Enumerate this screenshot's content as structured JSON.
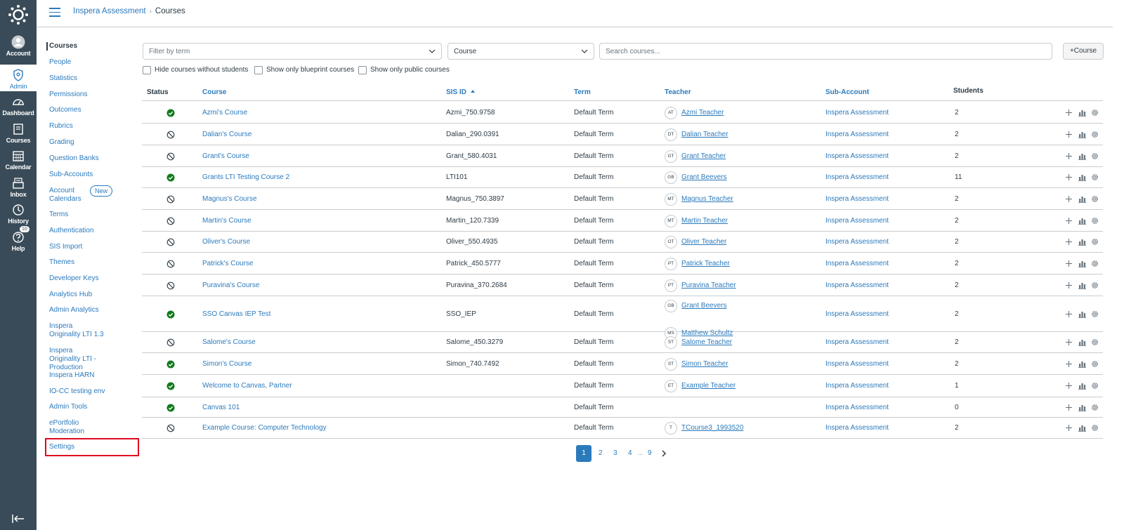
{
  "global_nav": {
    "items": [
      {
        "label": "Account",
        "icon": "account-icon"
      },
      {
        "label": "Admin",
        "icon": "admin-shield-icon"
      },
      {
        "label": "Dashboard",
        "icon": "dashboard-icon"
      },
      {
        "label": "Courses",
        "icon": "courses-icon"
      },
      {
        "label": "Calendar",
        "icon": "calendar-icon"
      },
      {
        "label": "Inbox",
        "icon": "inbox-icon"
      },
      {
        "label": "History",
        "icon": "history-icon"
      },
      {
        "label": "Help",
        "icon": "help-icon",
        "badge": "10"
      }
    ]
  },
  "breadcrumb": {
    "root": "Inspera Assessment",
    "current": "Courses"
  },
  "sidebar": {
    "items": [
      {
        "label": "Courses"
      },
      {
        "label": "People"
      },
      {
        "label": "Statistics"
      },
      {
        "label": "Permissions"
      },
      {
        "label": "Outcomes"
      },
      {
        "label": "Rubrics"
      },
      {
        "label": "Grading"
      },
      {
        "label": "Question Banks"
      },
      {
        "label": "Sub-Accounts"
      },
      {
        "label": "Account Calendars",
        "badge": "New"
      },
      {
        "label": "Terms"
      },
      {
        "label": "Authentication"
      },
      {
        "label": "SIS Import"
      },
      {
        "label": "Themes"
      },
      {
        "label": "Developer Keys"
      },
      {
        "label": "Analytics Hub"
      },
      {
        "label": "Admin Analytics"
      },
      {
        "label": "Inspera Originality LTI 1.3"
      },
      {
        "label": "Inspera Originality LTI - Production"
      },
      {
        "label": "Inspera HARN"
      },
      {
        "label": "IO-CC testing env"
      },
      {
        "label": "Admin Tools"
      },
      {
        "label": "ePortfolio Moderation"
      },
      {
        "label": "Settings"
      }
    ]
  },
  "filters": {
    "term_placeholder": "Filter by term",
    "type_value": "Course",
    "search_placeholder": "Search courses...",
    "add_course_label": "+Course",
    "checkboxes": [
      "Hide courses without students",
      "Show only blueprint courses",
      "Show only public courses"
    ]
  },
  "table": {
    "headers": {
      "status": "Status",
      "course": "Course",
      "sis": "SIS ID",
      "term": "Term",
      "teacher": "Teacher",
      "sub": "Sub-Account",
      "students": "Students"
    },
    "rows": [
      {
        "status": "published",
        "course": "Azmi's Course",
        "sis": "Azmi_750.9758",
        "term": "Default Term",
        "teachers": [
          {
            "initials": "AT",
            "name": "Azmi Teacher"
          }
        ],
        "sub": "Inspera Assessment",
        "students": "2"
      },
      {
        "status": "unpublished",
        "course": "Dalian's Course",
        "sis": "Dalian_290.0391",
        "term": "Default Term",
        "teachers": [
          {
            "initials": "DT",
            "name": "Dalian Teacher"
          }
        ],
        "sub": "Inspera Assessment",
        "students": "2"
      },
      {
        "status": "unpublished",
        "course": "Grant's Course",
        "sis": "Grant_580.4031",
        "term": "Default Term",
        "teachers": [
          {
            "initials": "GT",
            "name": "Grant Teacher"
          }
        ],
        "sub": "Inspera Assessment",
        "students": "2"
      },
      {
        "status": "published",
        "course": "Grants LTI Testing Course 2",
        "sis": "LTI101",
        "term": "Default Term",
        "teachers": [
          {
            "initials": "GB",
            "name": "Grant Beevers"
          }
        ],
        "sub": "Inspera Assessment",
        "students": "11"
      },
      {
        "status": "unpublished",
        "course": "Magnus's Course",
        "sis": "Magnus_750.3897",
        "term": "Default Term",
        "teachers": [
          {
            "initials": "MT",
            "name": "Magnus Teacher"
          }
        ],
        "sub": "Inspera Assessment",
        "students": "2"
      },
      {
        "status": "unpublished",
        "course": "Martin's Course",
        "sis": "Martin_120.7339",
        "term": "Default Term",
        "teachers": [
          {
            "initials": "MT",
            "name": "Martin Teacher"
          }
        ],
        "sub": "Inspera Assessment",
        "students": "2"
      },
      {
        "status": "unpublished",
        "course": "Oliver's Course",
        "sis": "Oliver_550.4935",
        "term": "Default Term",
        "teachers": [
          {
            "initials": "OT",
            "name": "Oliver Teacher"
          }
        ],
        "sub": "Inspera Assessment",
        "students": "2"
      },
      {
        "status": "unpublished",
        "course": "Patrick's Course",
        "sis": "Patrick_450.5777",
        "term": "Default Term",
        "teachers": [
          {
            "initials": "PT",
            "name": "Patrick Teacher"
          }
        ],
        "sub": "Inspera Assessment",
        "students": "2"
      },
      {
        "status": "unpublished",
        "course": "Puravina's Course",
        "sis": "Puravina_370.2684",
        "term": "Default Term",
        "teachers": [
          {
            "initials": "PT",
            "name": "Puravina Teacher"
          }
        ],
        "sub": "Inspera Assessment",
        "students": "2"
      },
      {
        "status": "published",
        "course": "SSO Canvas IEP Test",
        "sis": "SSO_IEP",
        "term": "Default Term",
        "teachers": [
          {
            "initials": "GB",
            "name": "Grant Beevers"
          },
          {
            "initials": "MS",
            "name": "Matthew Schultz"
          }
        ],
        "sub": "Inspera Assessment",
        "students": "2"
      },
      {
        "status": "unpublished",
        "course": "Salome's Course",
        "sis": "Salome_450.3279",
        "term": "Default Term",
        "teachers": [
          {
            "initials": "ST",
            "name": "Salome Teacher"
          }
        ],
        "sub": "Inspera Assessment",
        "students": "2"
      },
      {
        "status": "published",
        "course": "Simon's Course",
        "sis": "Simon_740.7492",
        "term": "Default Term",
        "teachers": [
          {
            "initials": "ST",
            "name": "Simon Teacher"
          }
        ],
        "sub": "Inspera Assessment",
        "students": "2"
      },
      {
        "status": "published",
        "course": "Welcome to Canvas, Partner",
        "sis": "",
        "term": "Default Term",
        "teachers": [
          {
            "initials": "ET",
            "name": "Example Teacher"
          }
        ],
        "sub": "Inspera Assessment",
        "students": "1"
      },
      {
        "status": "published",
        "course": "Canvas 101",
        "sis": "",
        "term": "Default Term",
        "teachers": [],
        "sub": "Inspera Assessment",
        "students": "0"
      },
      {
        "status": "unpublished",
        "course": "Example Course: Computer Technology",
        "sis": "",
        "term": "Default Term",
        "teachers": [
          {
            "initials": "T",
            "name": "TCourse3_1993520"
          }
        ],
        "sub": "Inspera Assessment",
        "students": "2"
      }
    ]
  },
  "pagination": {
    "pages": [
      "1",
      "2",
      "3",
      "4",
      "...",
      "9"
    ],
    "current": "1"
  },
  "colors": {
    "nav_bg": "#394b58",
    "link": "#2b7abc",
    "published": "#127a1b",
    "highlight": "#e0061f"
  }
}
